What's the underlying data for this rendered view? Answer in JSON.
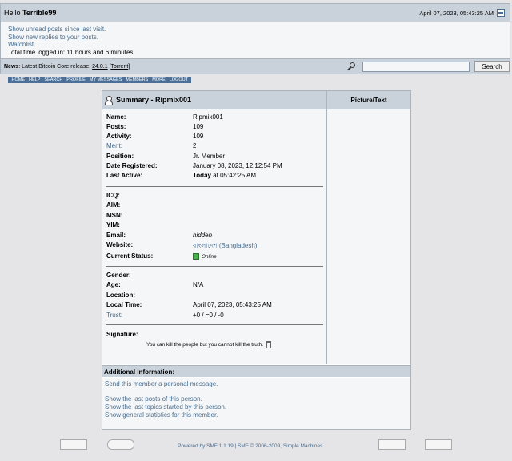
{
  "header": {
    "hello_prefix": "Hello",
    "username": "Terrible99",
    "datetime": "April 07, 2023, 05:43:25 AM"
  },
  "userbox": {
    "links": [
      "Show unread posts since last visit.",
      "Show new replies to your posts.",
      "Watchlist"
    ],
    "time_logged": "Total time logged in: 11 hours and 6 minutes."
  },
  "newsbar": {
    "label": "News",
    "text": ": Latest Bitcoin Core release: ",
    "version": "24.0.1",
    "torrent": "[Torrent]",
    "search_button": "Search",
    "search_placeholder": ""
  },
  "menu": [
    "HOME",
    "HELP",
    "SEARCH",
    "PROFILE",
    "MY MESSAGES",
    "MEMBERS",
    "MORE",
    "LOGOUT"
  ],
  "summary": {
    "title": "Summary - Ripmix001",
    "picture_header": "Picture/Text",
    "rows": [
      {
        "label": "Name:",
        "value": "Ripmix001"
      },
      {
        "label": "Posts:",
        "value": "109"
      },
      {
        "label": "Activity:",
        "value": "109"
      },
      {
        "label": "Merit:",
        "value": "2"
      },
      {
        "label": "Position:",
        "value": "Jr. Member"
      },
      {
        "label": "Date Registered:",
        "value": "January 08, 2023, 12:12:54 PM"
      },
      {
        "label": "Last Active:",
        "value_bold": "Today",
        "value": " at 05:42:25 AM"
      }
    ],
    "contact_rows": [
      {
        "label": "ICQ:",
        "value": ""
      },
      {
        "label": "AIM:",
        "value": ""
      },
      {
        "label": "MSN:",
        "value": ""
      },
      {
        "label": "YIM:",
        "value": ""
      },
      {
        "label": "Email:",
        "value": "hidden"
      },
      {
        "label": "Website:",
        "value": "বাংলাদেশ (Bangladesh)"
      },
      {
        "label": "Current Status:",
        "value": "Online"
      }
    ],
    "personal_rows": [
      {
        "label": "Gender:",
        "value": ""
      },
      {
        "label": "Age:",
        "value": "N/A"
      },
      {
        "label": "Location:",
        "value": ""
      },
      {
        "label": "Local Time:",
        "value": "April 07, 2023, 05:43:25 AM"
      },
      {
        "label": "Trust:",
        "value": "+0 / =0 / -0"
      }
    ],
    "signature_label": "Signature:",
    "signature_text": "You can kill the people but you cannot kill the truth."
  },
  "additional": {
    "title": "Additional Information:",
    "links": [
      "Send this member a personal message.",
      "Show the last posts of this person.",
      "Show the last topics started by this person.",
      "Show general statistics for this member."
    ]
  },
  "footer": {
    "powered": "Powered by SMF 1.1.19 | SMF © 2006-2009, Simple Machines"
  },
  "colors": {
    "header_bg": "#c9d2db",
    "link": "#476c8e",
    "menu_bg": "#4b6f96",
    "online": "#4caf50"
  }
}
